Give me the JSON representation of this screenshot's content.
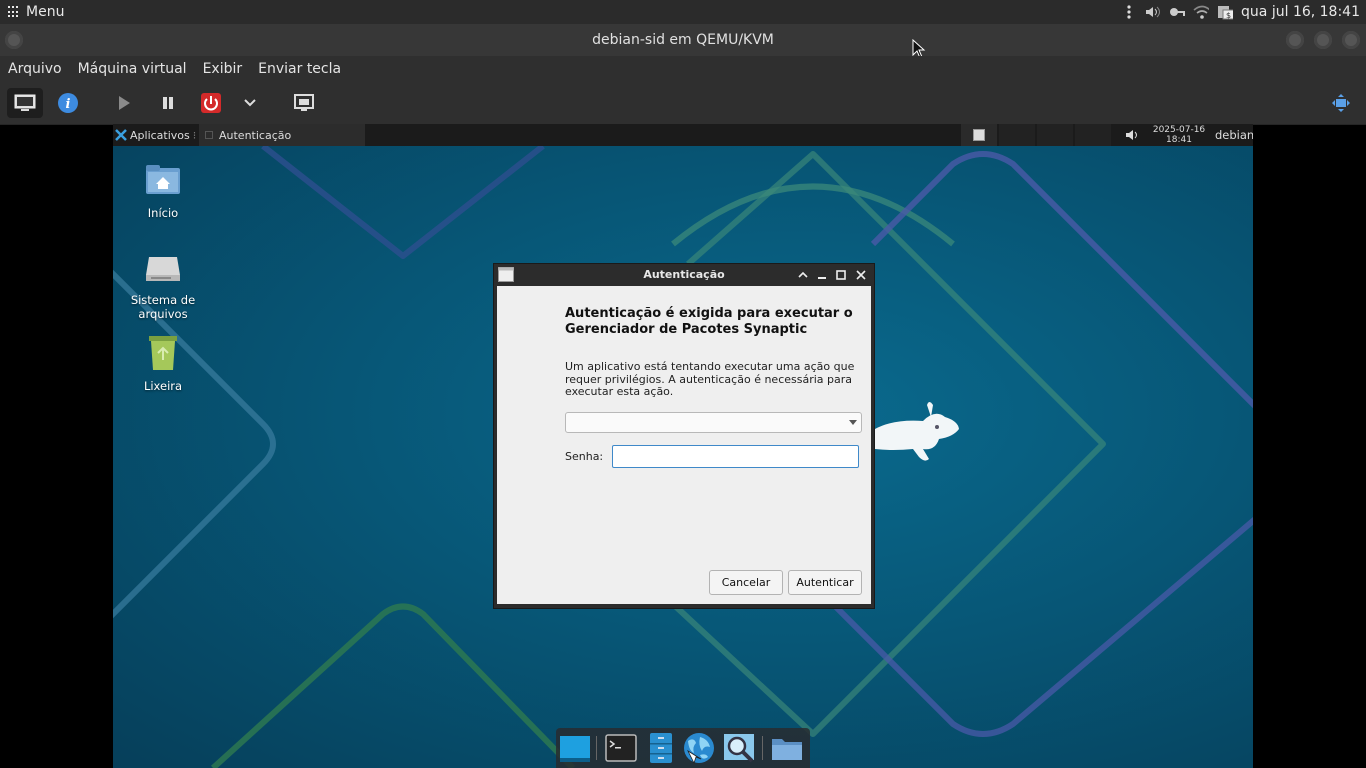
{
  "host_panel": {
    "menu_label": "Menu",
    "clock": "qua jul 16, 18:41"
  },
  "window": {
    "title": "debian-sid em QEMU/KVM"
  },
  "menubar": [
    "Arquivo",
    "Máquina virtual",
    "Exibir",
    "Enviar tecla"
  ],
  "toolbar": {
    "icons": [
      "console-icon",
      "info-icon",
      "run-icon",
      "pause-icon",
      "shutdown-icon",
      "dropdown-chevron-icon",
      "snapshot-icon",
      "fullscreen-icon"
    ]
  },
  "guest": {
    "panel": {
      "apps_label": "Aplicativos",
      "task_label": "Autenticação",
      "date": "2025-07-16",
      "time": "18:41",
      "user": "debian"
    },
    "desktop_icons": [
      "Início",
      "Sistema de arquivos",
      "Lixeira"
    ],
    "desktop_icon_lines": {
      "fs_line1": "Sistema de",
      "fs_line2": "arquivos"
    }
  },
  "dialog": {
    "title": "Autenticação",
    "heading": "Autenticação é exigida para executar o Gerenciador de Pacotes Synaptic",
    "description": "Um aplicativo está tentando executar uma ação que requer privilégios. A autenticação é necessária para executar esta ação.",
    "user_select_value": "",
    "password_label": "Senha:",
    "password_value": "",
    "cancel_label": "Cancelar",
    "authenticate_label": "Autenticar"
  },
  "dock": {
    "icons": [
      "show-desktop-icon",
      "terminal-icon",
      "file-manager-icon",
      "web-browser-icon",
      "app-finder-icon",
      "folder-icon"
    ]
  },
  "colors": {
    "accent": "#3f89c9",
    "power_red": "#d42a2a",
    "info_blue": "#3d8be0",
    "desktop_teal": "#075777"
  }
}
